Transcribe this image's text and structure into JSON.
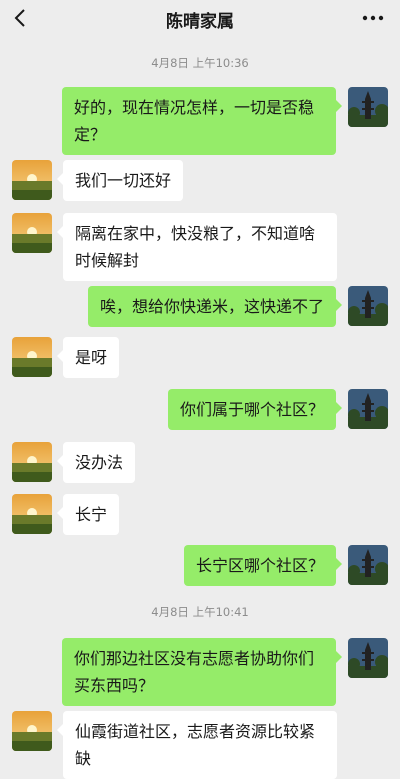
{
  "header": {
    "title": "陈晴家属"
  },
  "messages": [
    {
      "type": "time",
      "text": "4月8日 上午10:36"
    },
    {
      "type": "msg",
      "side": "right",
      "text": "好的，现在情况怎样，一切是否稳定？"
    },
    {
      "type": "msg",
      "side": "left",
      "text": "我们一切还好"
    },
    {
      "type": "msg",
      "side": "left",
      "text": "隔离在家中，快没粮了，不知道啥时候解封"
    },
    {
      "type": "msg",
      "side": "right",
      "text": "唉，想给你快递米，这快递不了"
    },
    {
      "type": "msg",
      "side": "left",
      "text": "是呀"
    },
    {
      "type": "msg",
      "side": "right",
      "text": "你们属于哪个社区？"
    },
    {
      "type": "msg",
      "side": "left",
      "text": "没办法"
    },
    {
      "type": "msg",
      "side": "left",
      "text": "长宁"
    },
    {
      "type": "msg",
      "side": "right",
      "text": "长宁区哪个社区？"
    },
    {
      "type": "time",
      "text": "4月8日 上午10:41"
    },
    {
      "type": "msg",
      "side": "right",
      "text": "你们那边社区没有志愿者协助你们买东西吗？"
    },
    {
      "type": "msg",
      "side": "left",
      "text": "仙霞街道社区，志愿者资源比较紧缺"
    }
  ]
}
